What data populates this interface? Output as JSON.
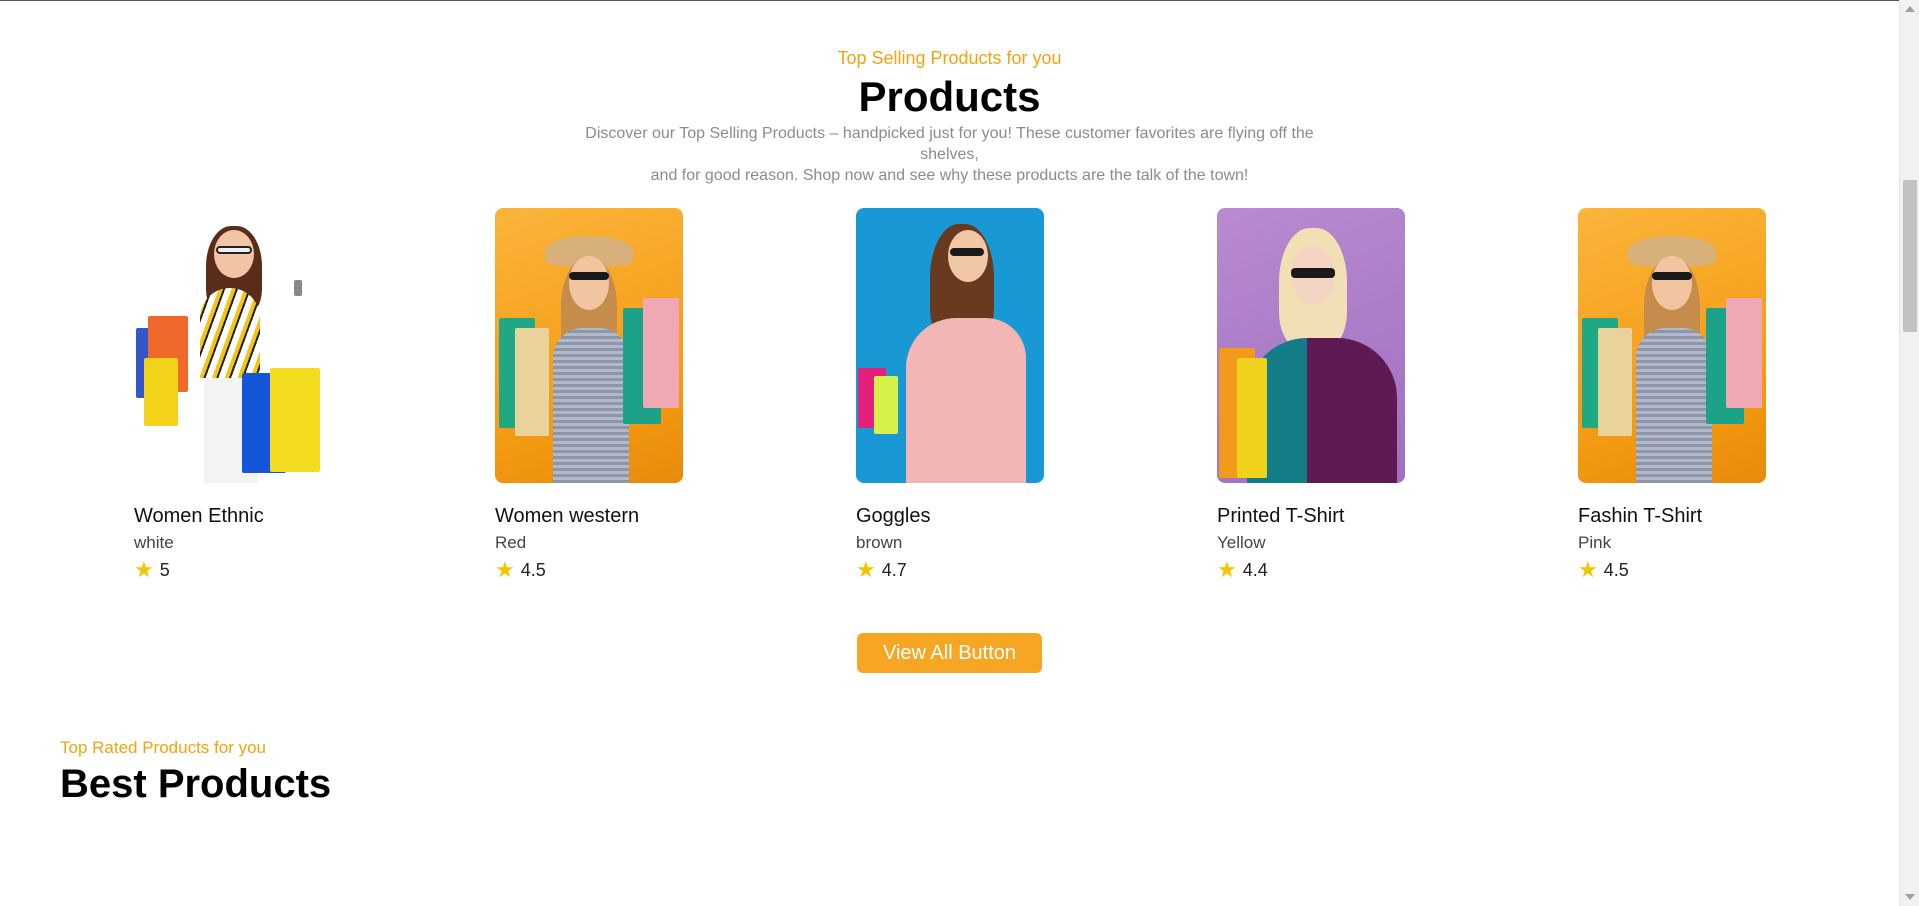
{
  "section": {
    "subtitle": "Top Selling Products for you",
    "title": "Products",
    "description_line1": "Discover our Top Selling Products – handpicked just for you! These customer favorites are flying off the shelves,",
    "description_line2": "and for good reason. Shop now and see why these products are the talk of the town!"
  },
  "products": [
    {
      "name": "Women Ethnic",
      "color": "white",
      "rating": "5",
      "image_icon": "woman-shopping-bags-photo"
    },
    {
      "name": "Women western",
      "color": "Red",
      "rating": "4.5",
      "image_icon": "woman-shopping-bags-photo"
    },
    {
      "name": "Goggles",
      "color": "brown",
      "rating": "4.7",
      "image_icon": "woman-sunglasses-photo"
    },
    {
      "name": "Printed T-Shirt",
      "color": "Yellow",
      "rating": "4.4",
      "image_icon": "woman-shopping-bags-photo"
    },
    {
      "name": "Fashin T-Shirt",
      "color": "Pink",
      "rating": "4.5",
      "image_icon": "woman-shopping-bags-photo"
    }
  ],
  "view_all_label": "View All Button",
  "best": {
    "subtitle": "Top Rated Products for you",
    "title": "Best Products"
  },
  "colors": {
    "accent": "#f7a623",
    "subtitle": "#f5a20f",
    "star": "#f5c400"
  }
}
